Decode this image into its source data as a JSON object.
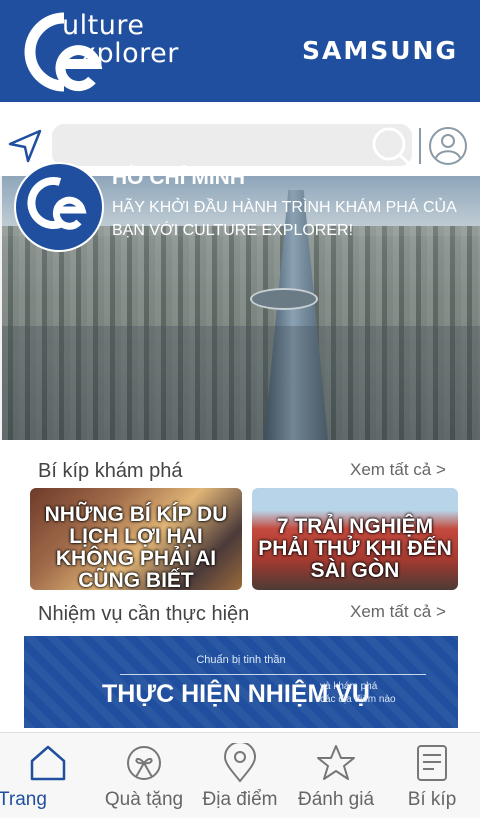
{
  "header": {
    "logo_line1": "ulture",
    "logo_line2": "xplorer",
    "brand": "SAMSUNG",
    "colors": {
      "primary": "#1f4f9e"
    }
  },
  "search": {
    "value": "",
    "placeholder": ""
  },
  "hero": {
    "title": "HỒ CHÍ MINH",
    "desc_line1": "HÃY KHỞI ĐẦU HÀNH TRÌNH KHÁM PHÁ CỦA",
    "desc_line2": "BẠN VỚI CULTURE EXPLORER!"
  },
  "tips": {
    "title": "Bí kíp khám phá",
    "see_all": "Xem tất cả >",
    "cards": [
      {
        "title": "NHỮNG BÍ KÍP DU LỊCH LỢI HẠI KHÔNG PHẢI AI CŨNG BIẾT"
      },
      {
        "title": "7 TRẢI NGHIỆM PHẢI THỬ KHI ĐẾN SÀI GÒN"
      }
    ]
  },
  "missions": {
    "title": "Nhiệm vụ cần thực hiện",
    "see_all": "Xem tất cả >",
    "banner": {
      "small": "Chuẩn bị tinh thần",
      "big": "THỰC HIỆN NHIỆM VỤ",
      "side_line1": "và khám phá",
      "side_line2": "các địa điểm nào"
    }
  },
  "nav": {
    "items": [
      {
        "label": "Trang",
        "icon": "home-icon",
        "active": true
      },
      {
        "label": "Quà tặng",
        "icon": "gift-icon"
      },
      {
        "label": "Địa điểm",
        "icon": "location-pin-icon"
      },
      {
        "label": "Đánh giá",
        "icon": "star-icon"
      },
      {
        "label": "Bí kíp",
        "icon": "document-icon"
      }
    ]
  }
}
